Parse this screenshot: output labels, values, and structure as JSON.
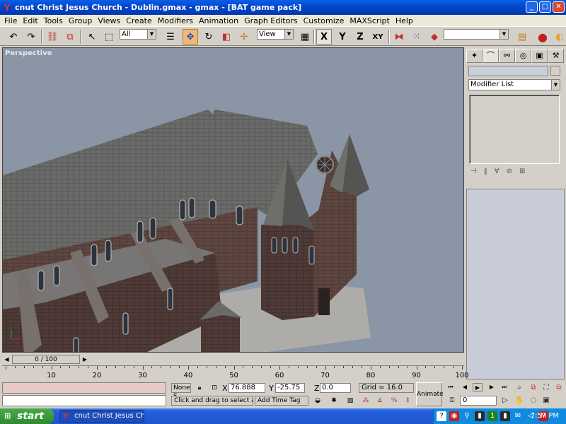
{
  "window": {
    "title": "cnut Christ Jesus Church - Dublin.gmax - gmax - [BAT game pack]",
    "minimize_glyph": "_",
    "maximize_glyph": "□",
    "close_glyph": "✕"
  },
  "menu": [
    "File",
    "Edit",
    "Tools",
    "Group",
    "Views",
    "Create",
    "Modifiers",
    "Animation",
    "Graph Editors",
    "Customize",
    "MAXScript",
    "Help"
  ],
  "toolbar": {
    "selection_filter": "All",
    "reference_coord": "View",
    "axis_x": "X",
    "axis_y": "Y",
    "axis_z": "Z",
    "axis_xy": "XY",
    "named_selection": ""
  },
  "viewport": {
    "label": "Perspective"
  },
  "command_panel": {
    "modifier_list": "Modifier List"
  },
  "time_slider": {
    "position": "0 / 100",
    "ticks": [
      "10",
      "20",
      "30",
      "40",
      "50",
      "60",
      "70",
      "80",
      "90",
      "100"
    ]
  },
  "status": {
    "selection": "None S",
    "x_label": "X",
    "x_value": "76.888",
    "y_label": "Y",
    "y_value": "-25.75",
    "z_label": "Z",
    "z_value": "0.0",
    "grid": "Grid = 16.0",
    "prompt": "Click and drag to select and m",
    "add_time_tag": "Add Time Tag",
    "animate": "Animate",
    "current_frame": "0"
  },
  "taskbar": {
    "start": "start",
    "task_item": "cnut Christ Jesus Chu...",
    "clock": "7:57 PM"
  },
  "colors": {
    "viewport_bg": "#8a95a5",
    "titlebar": "#0044c8",
    "active_tool": "#f0b878",
    "taskbar": "#245edc",
    "start_button": "#2d8a2d"
  }
}
